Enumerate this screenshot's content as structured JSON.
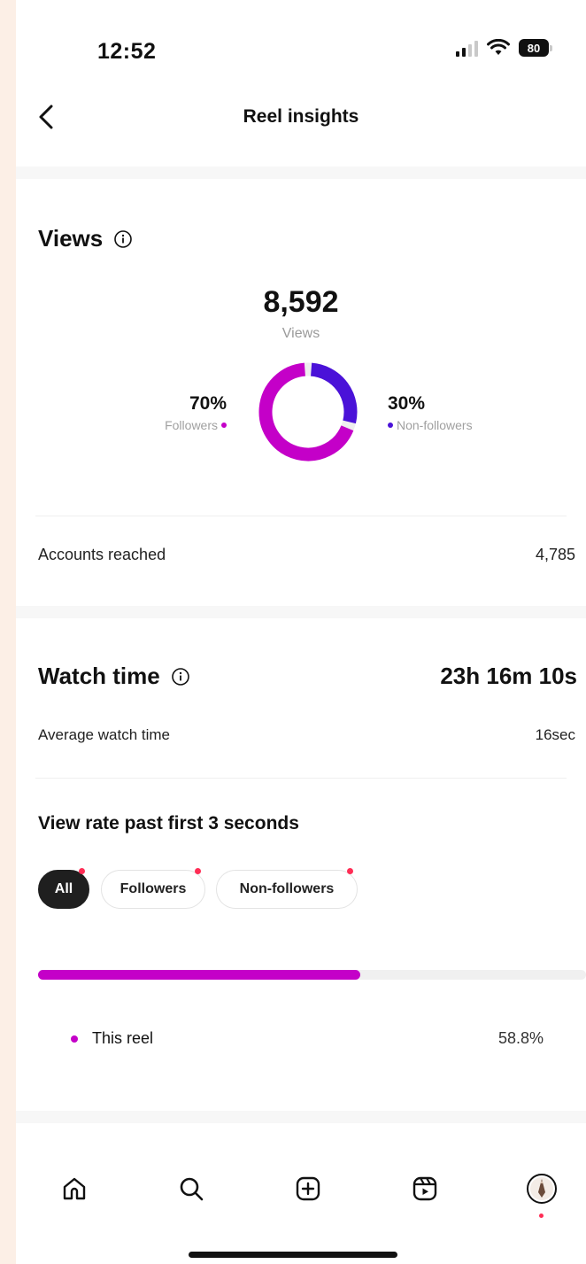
{
  "status_bar": {
    "time": "12:52",
    "battery": "80"
  },
  "header": {
    "title": "Reel insights"
  },
  "views": {
    "title": "Views",
    "total": "8,592",
    "total_caption": "Views",
    "followers_pct": "70%",
    "followers_label": "Followers",
    "non_followers_pct": "30%",
    "non_followers_label": "Non-followers",
    "donut_fractions": {
      "followers": 0.7,
      "non_followers": 0.3
    }
  },
  "accounts_reached": {
    "label": "Accounts reached",
    "value": "4,785"
  },
  "watch_time": {
    "title": "Watch time",
    "total": "23h 16m 10s",
    "avg_label": "Average watch time",
    "avg_value": "16sec"
  },
  "view_rate": {
    "title": "View rate past first 3 seconds",
    "chips": [
      {
        "label": "All",
        "active": true
      },
      {
        "label": "Followers",
        "active": false
      },
      {
        "label": "Non-followers",
        "active": false
      }
    ],
    "progress": 0.588,
    "legend_label": "This reel",
    "legend_value": "58.8%"
  },
  "tab_bar": {
    "icons": [
      "home-icon",
      "search-icon",
      "create-icon",
      "reels-icon",
      "profile-avatar"
    ]
  },
  "colors": {
    "followers": "#c400c8",
    "non_followers": "#4a12d8",
    "badge": "#ff2d55"
  }
}
